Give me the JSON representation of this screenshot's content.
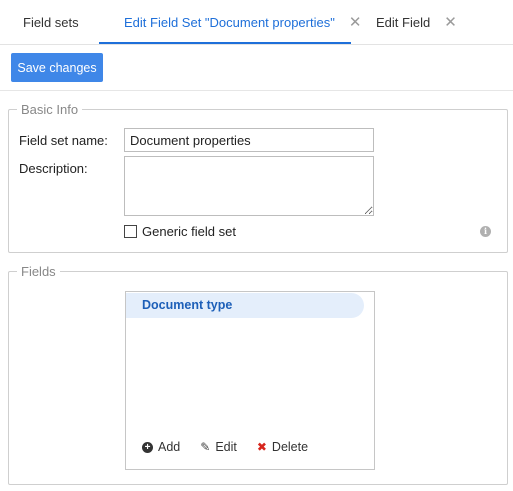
{
  "tabs": [
    {
      "label": "Field sets",
      "closable": false,
      "active": false
    },
    {
      "label": "Edit Field Set \"Document properties\"",
      "closable": true,
      "active": true
    },
    {
      "label": "Edit Field",
      "closable": true,
      "active": false
    }
  ],
  "toolbar": {
    "save_label": "Save changes"
  },
  "basic_info": {
    "legend": "Basic Info",
    "name_label": "Field set name:",
    "name_value": "Document properties",
    "description_label": "Description:",
    "description_value": "",
    "generic_label": "Generic field set",
    "generic_checked": false,
    "info_icon": "info-icon"
  },
  "fields": {
    "legend": "Fields",
    "items": [
      "Document type"
    ],
    "actions": {
      "add": "Add",
      "edit": "Edit",
      "delete": "Delete"
    }
  },
  "colors": {
    "accent": "#1e6fd9",
    "button": "#3f87e8",
    "selected_bg": "#e4eefb",
    "delete": "#d7261d"
  }
}
